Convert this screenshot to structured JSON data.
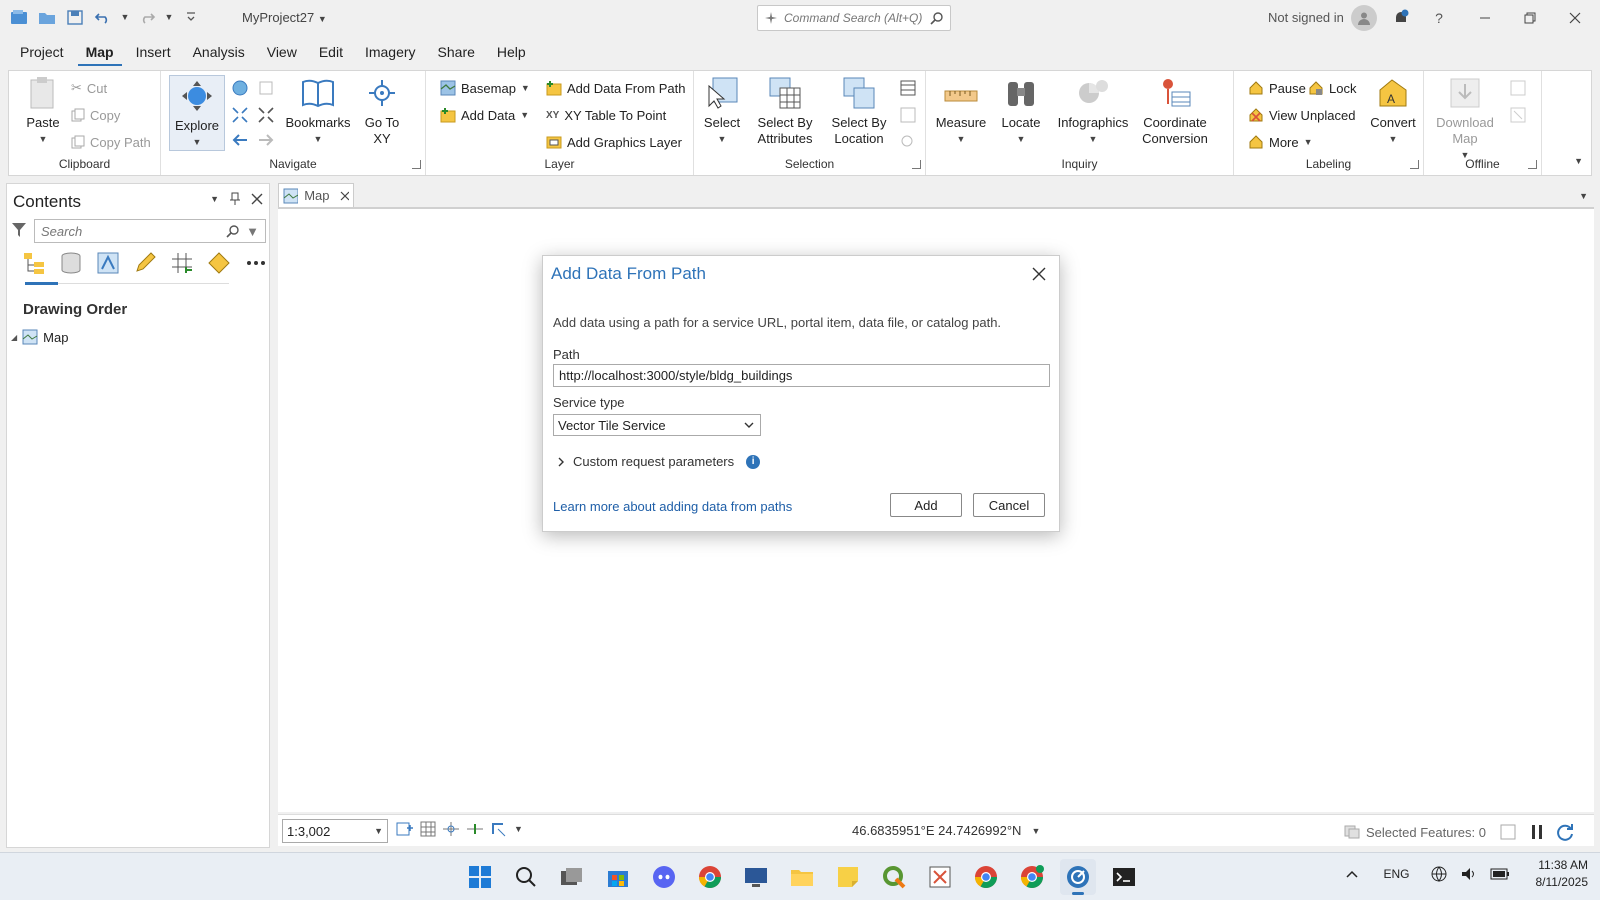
{
  "titlebar": {
    "project_name": "MyProject27",
    "command_search_placeholder": "Command Search (Alt+Q)",
    "signin_status": "Not signed in"
  },
  "menu_tabs": [
    "Project",
    "Map",
    "Insert",
    "Analysis",
    "View",
    "Edit",
    "Imagery",
    "Share",
    "Help"
  ],
  "active_tab": "Map",
  "ribbon": {
    "clipboard": {
      "label": "Clipboard",
      "paste": "Paste",
      "cut": "Cut",
      "copy": "Copy",
      "copy_path": "Copy Path"
    },
    "navigate": {
      "label": "Navigate",
      "explore": "Explore",
      "bookmarks": "Bookmarks",
      "go_to_xy": "Go To XY"
    },
    "layer": {
      "label": "Layer",
      "basemap": "Basemap",
      "add_data": "Add Data",
      "add_data_from_path": "Add Data From Path",
      "xy_table": "XY Table To Point",
      "add_graphics": "Add Graphics Layer"
    },
    "selection": {
      "label": "Selection",
      "select": "Select",
      "select_by_attributes": "Select By Attributes",
      "select_by_location": "Select By Location"
    },
    "inquiry": {
      "label": "Inquiry",
      "measure": "Measure",
      "locate": "Locate",
      "infographics": "Infographics",
      "coordinate_conversion": "Coordinate Conversion"
    },
    "labeling": {
      "label": "Labeling",
      "pause": "Pause",
      "lock": "Lock",
      "view_unplaced": "View Unplaced",
      "more": "More",
      "convert": "Convert"
    },
    "offline": {
      "label": "Offline",
      "download_map": "Download Map"
    }
  },
  "contents": {
    "title": "Contents",
    "search_placeholder": "Search",
    "section": "Drawing Order",
    "map_item": "Map"
  },
  "map_view": {
    "tab": "Map",
    "scale": "1:3,002",
    "coordinates": "46.6835951°E 24.7426992°N",
    "selected_features": "Selected Features: 0"
  },
  "dialog": {
    "title": "Add Data From Path",
    "description": "Add data using a path for a service URL, portal item, data file, or catalog path.",
    "path_label": "Path",
    "path_value": "http://localhost:3000/style/bldg_buildings",
    "service_type_label": "Service type",
    "service_type_value": "Vector Tile Service",
    "custom_params": "Custom request parameters",
    "learn_more": "Learn more about adding data from paths",
    "add": "Add",
    "cancel": "Cancel"
  },
  "taskbar": {
    "language": "ENG",
    "time": "11:38 AM",
    "date": "8/11/2025"
  },
  "colors": {
    "accent": "#2e73b8",
    "link": "#1f5fa8"
  }
}
